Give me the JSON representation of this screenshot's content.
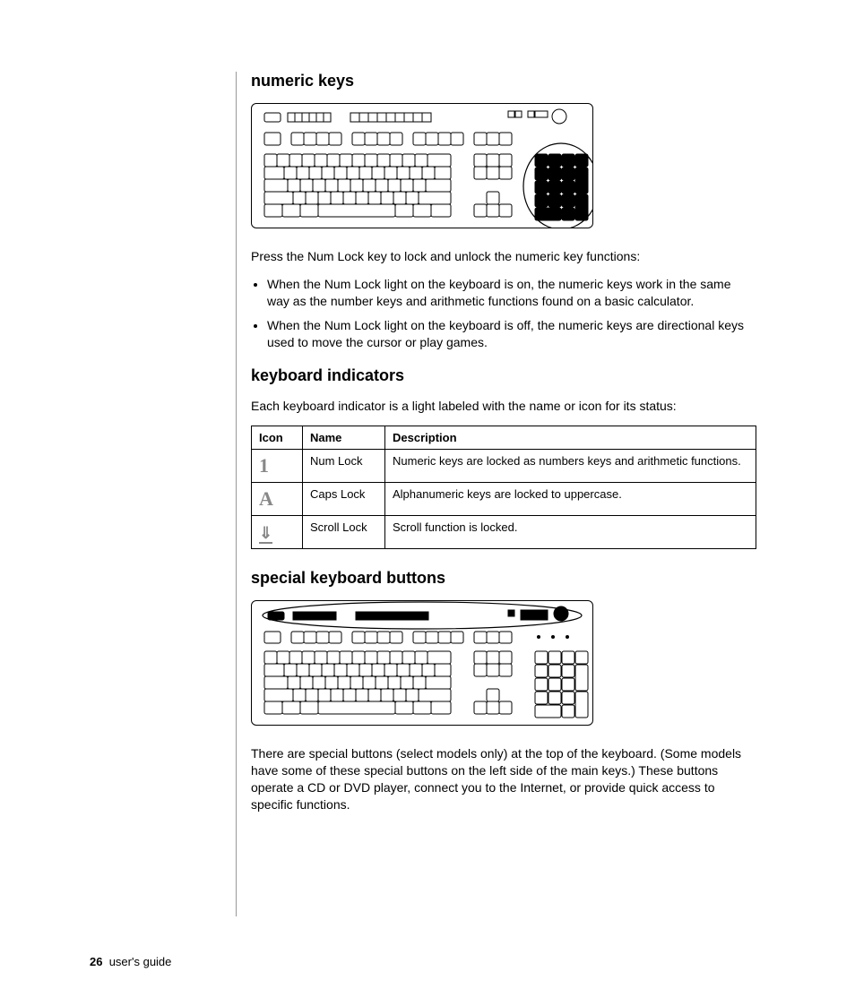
{
  "sections": {
    "s1": {
      "heading": "numeric keys",
      "para": "Press the Num Lock key to lock and unlock the numeric key functions:",
      "bullets": [
        "When the Num Lock light on the keyboard is on, the numeric keys work in the same way as the number keys and arithmetic functions found on a basic calculator.",
        "When the Num Lock light on the keyboard is off, the numeric keys are directional keys used to move the cursor or play games."
      ]
    },
    "s2": {
      "heading": "keyboard indicators",
      "para": "Each keyboard indicator is a light labeled with the name or icon for its status:",
      "table_headers": {
        "icon": "Icon",
        "name": "Name",
        "desc": "Description"
      },
      "rows": [
        {
          "icon": "1",
          "name": "Num Lock",
          "desc": "Numeric keys are locked as numbers keys and arithmetic functions."
        },
        {
          "icon": "A",
          "name": "Caps Lock",
          "desc": "Alphanumeric keys are locked to uppercase."
        },
        {
          "icon": "scroll",
          "name": "Scroll Lock",
          "desc": "Scroll function is locked."
        }
      ]
    },
    "s3": {
      "heading": "special keyboard buttons",
      "para": "There are special buttons (select models only) at the top of the keyboard. (Some models have some of these special buttons on the left side of the main keys.) These buttons operate a CD or DVD player, connect you to the Internet, or provide quick access to specific functions."
    }
  },
  "footer": {
    "page": "26",
    "label": "user's guide"
  }
}
